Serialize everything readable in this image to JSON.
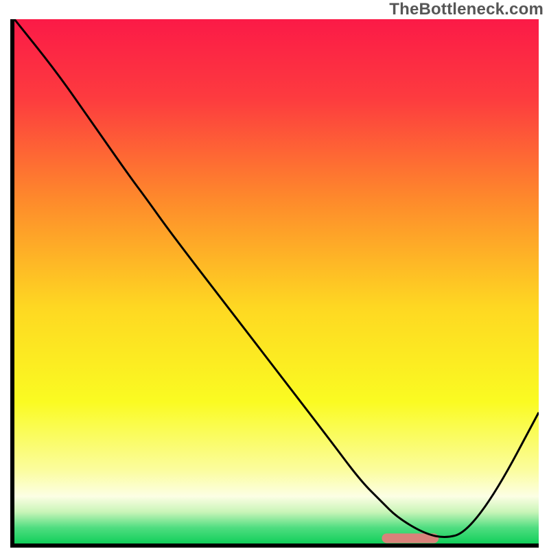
{
  "attribution": "TheBottleneck.com",
  "chart_data": {
    "type": "line",
    "title": "",
    "xlabel": "",
    "ylabel": "",
    "xlim": [
      0,
      100
    ],
    "ylim": [
      0,
      100
    ],
    "grid": false,
    "series": [
      {
        "name": "bottleneck-curve",
        "x": [
          0,
          8,
          15,
          22,
          25,
          30,
          40,
          50,
          60,
          66,
          70,
          73,
          78,
          82,
          86,
          92,
          100
        ],
        "values": [
          100,
          90,
          80,
          70,
          66,
          59,
          46,
          33,
          20,
          12,
          8,
          5,
          2,
          1,
          2,
          10,
          25
        ],
        "color": "#000000",
        "stroke_width": 3
      }
    ],
    "marker": {
      "name": "optimal-range",
      "x_range": [
        71,
        80
      ],
      "y": 1,
      "color": "#d9827a",
      "thickness": 14
    },
    "background_gradient": {
      "direction": "vertical",
      "stops": [
        {
          "pos": 0.0,
          "color": "#fb1a47"
        },
        {
          "pos": 0.15,
          "color": "#fd3b3f"
        },
        {
          "pos": 0.35,
          "color": "#fe8c2b"
        },
        {
          "pos": 0.55,
          "color": "#fed822"
        },
        {
          "pos": 0.73,
          "color": "#fafb22"
        },
        {
          "pos": 0.86,
          "color": "#fbfd9e"
        },
        {
          "pos": 0.91,
          "color": "#fcfee4"
        },
        {
          "pos": 0.94,
          "color": "#c9f5b8"
        },
        {
          "pos": 0.97,
          "color": "#4fdd80"
        },
        {
          "pos": 1.0,
          "color": "#11cf5a"
        }
      ]
    }
  }
}
